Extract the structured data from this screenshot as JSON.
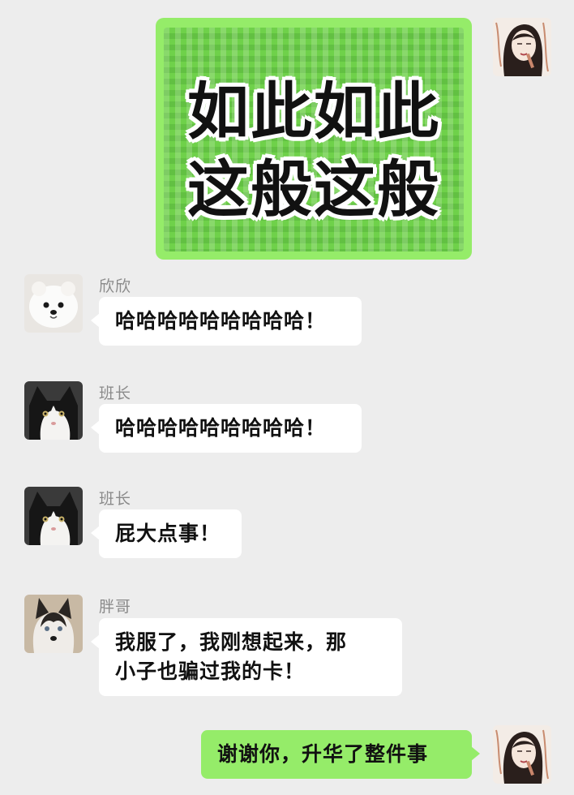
{
  "messages": [
    {
      "id": "m1",
      "direction": "out",
      "type": "sticker",
      "sticker_lines": [
        "如此如此",
        "这般这般"
      ],
      "avatar": "woman-sketch-avatar"
    },
    {
      "id": "m2",
      "direction": "in",
      "sender": "欣欣",
      "text": "哈哈哈哈哈哈哈哈哈！",
      "avatar": "white-dog-avatar"
    },
    {
      "id": "m3",
      "direction": "in",
      "sender": "班长",
      "text": "哈哈哈哈哈哈哈哈哈！",
      "avatar": "black-white-cat-avatar"
    },
    {
      "id": "m4",
      "direction": "in",
      "sender": "班长",
      "text": "屁大点事！",
      "avatar": "black-white-cat-avatar"
    },
    {
      "id": "m5",
      "direction": "in",
      "sender": "胖哥",
      "text_lines": [
        "我服了，我刚想起来，那",
        "小子也骗过我的卡！"
      ],
      "avatar": "husky-dog-avatar"
    },
    {
      "id": "m6",
      "direction": "out",
      "type": "text",
      "text": "谢谢你，升华了整件事",
      "avatar": "woman-sketch-avatar"
    }
  ],
  "colors": {
    "background": "#ededed",
    "outgoing_bubble": "#95ec69",
    "incoming_bubble": "#ffffff",
    "sender_name": "#8a8a8a",
    "message_text": "#111111"
  }
}
